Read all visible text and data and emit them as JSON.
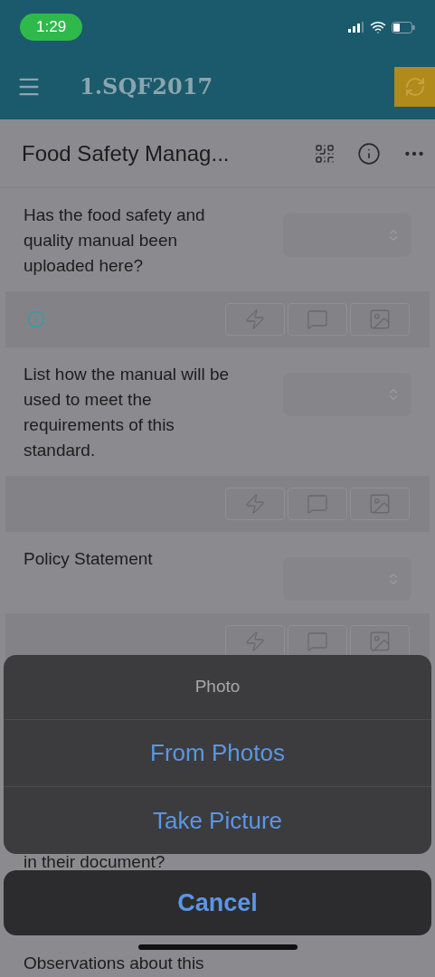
{
  "status_bar": {
    "time": "1:29"
  },
  "header": {
    "title": "1.SQF2017"
  },
  "page": {
    "title": "Food Safety Manag..."
  },
  "questions": [
    {
      "text": "Has the food safety and quality manual been uploaded here?",
      "has_info": true
    },
    {
      "text": "List how the manual will be used to meet the requirements of this standard.",
      "has_info": false
    },
    {
      "text": "Policy Statement",
      "has_info": false
    }
  ],
  "hidden_texts": [
    "in their document?",
    "Observations about this"
  ],
  "action_sheet": {
    "title": "Photo",
    "options": [
      "From Photos",
      "Take Picture"
    ],
    "cancel": "Cancel"
  }
}
